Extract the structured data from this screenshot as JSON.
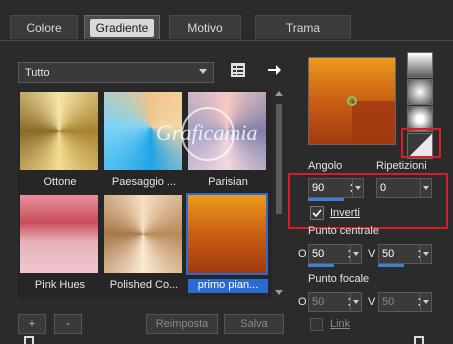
{
  "tabs": [
    {
      "label": "Colore"
    },
    {
      "label": "Gradiente"
    },
    {
      "label": "Motivo"
    },
    {
      "label": "Trama"
    }
  ],
  "library": {
    "category": "Tutto",
    "thumbnails": [
      {
        "label": "Ottone",
        "selected": false
      },
      {
        "label": "Paesaggio ...",
        "selected": false
      },
      {
        "label": "Parisian",
        "selected": false
      },
      {
        "label": "Pink Hues",
        "selected": false
      },
      {
        "label": "Polished Co...",
        "selected": false
      },
      {
        "label": "primo pian...",
        "selected": true
      }
    ],
    "add_label": "+",
    "remove_label": "-",
    "reset_label": "Reimposta",
    "save_label": "Salva"
  },
  "gradient": {
    "angle_label": "Angolo",
    "angle_value": "90",
    "repeat_label": "Ripetizioni",
    "repeat_value": "0",
    "invert_label": "Inverti",
    "invert_checked": true,
    "center_label": "Punto centrale",
    "center_h_axis": "O",
    "center_h_value": "50",
    "center_v_axis": "V",
    "center_v_value": "50",
    "focal_label": "Punto focale",
    "focal_h_axis": "O",
    "focal_h_value": "50",
    "focal_v_axis": "V",
    "focal_v_value": "50",
    "link_label": "Link"
  },
  "watermark_text": "Graficamia",
  "colors": {
    "accent": "#2a6bd1",
    "highlight_red": "#d81e24"
  }
}
